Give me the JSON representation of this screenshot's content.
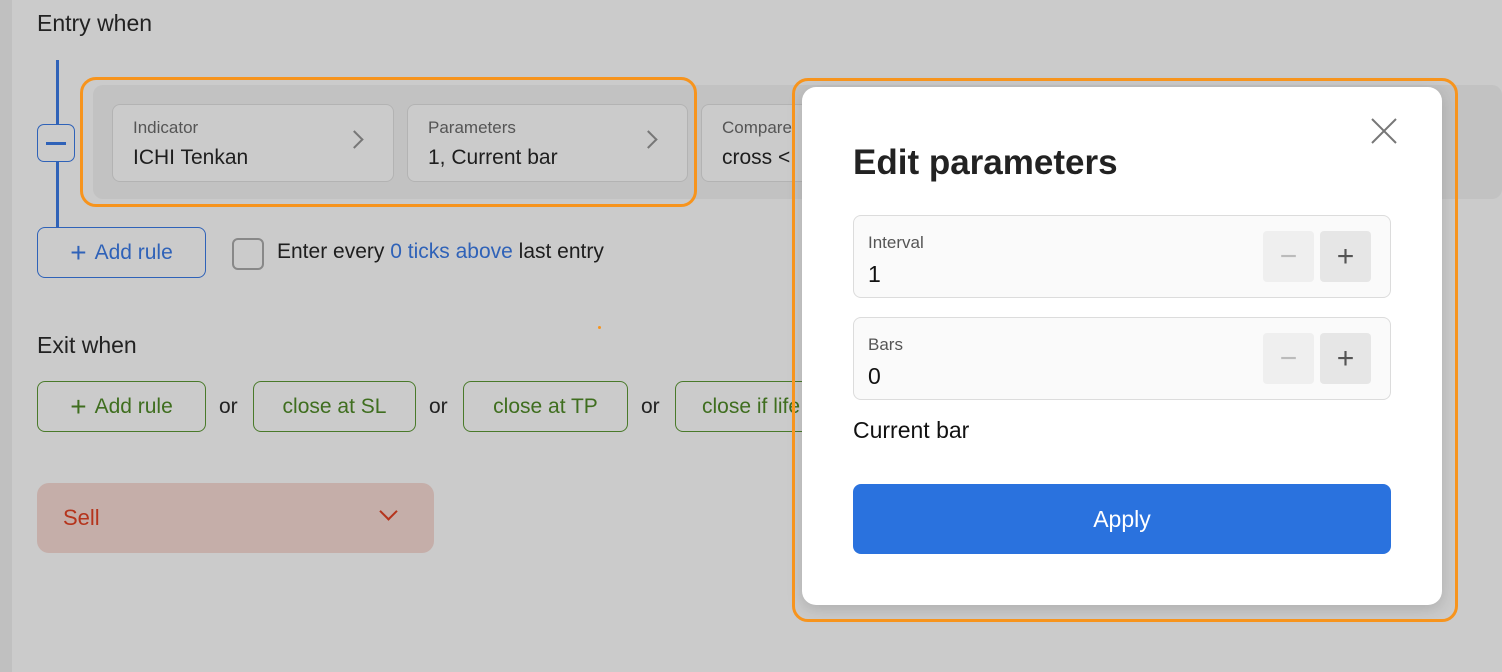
{
  "entry": {
    "title": "Entry when",
    "rule": {
      "indicator_label": "Indicator",
      "indicator_value": "ICHI Tenkan",
      "parameters_label": "Parameters",
      "parameters_value": "1, Current bar",
      "compare_label": "Compare",
      "compare_value": "cross <"
    },
    "add_rule": "Add rule",
    "enter_every": {
      "prefix": "Enter every",
      "link": "0 ticks above",
      "suffix": "last entry",
      "checked": false
    }
  },
  "exit": {
    "title": "Exit when",
    "add_rule": "Add rule",
    "or": "or",
    "buttons": [
      "close at SL",
      "close at TP",
      "close if life"
    ]
  },
  "direction": {
    "value": "Sell"
  },
  "modal": {
    "title": "Edit parameters",
    "fields": [
      {
        "label": "Interval",
        "value": "1"
      },
      {
        "label": "Bars",
        "value": "0"
      }
    ],
    "note": "Current bar",
    "apply": "Apply"
  },
  "colors": {
    "accent": "#2a72de",
    "highlight": "#f7941d",
    "sell": "#b5341c",
    "exit_green": "#3f6e1f"
  }
}
